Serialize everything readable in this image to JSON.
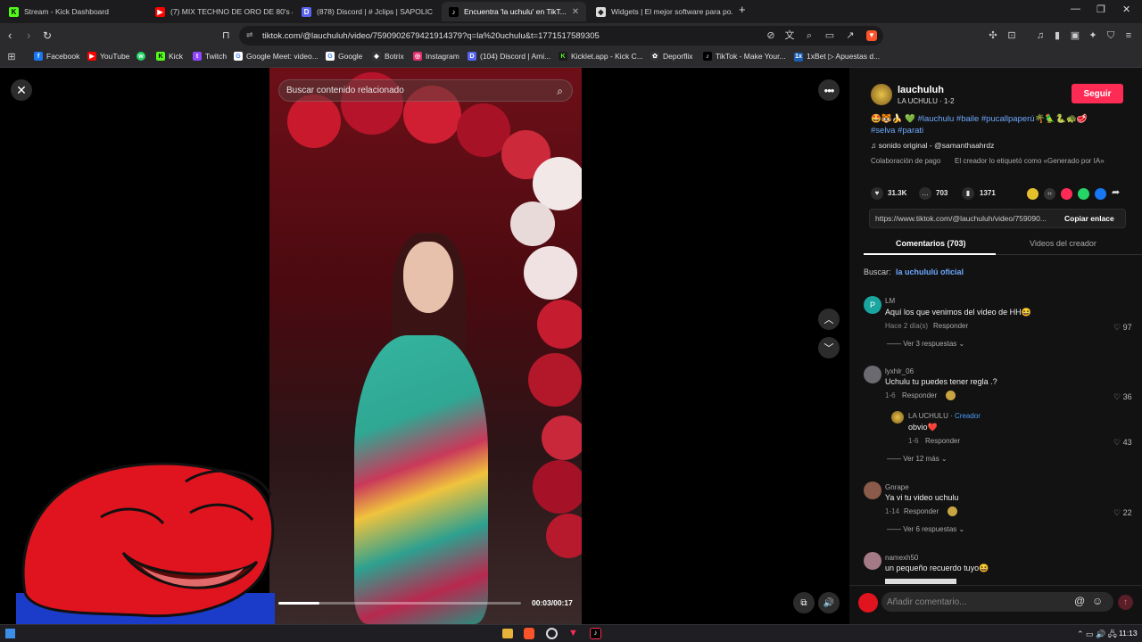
{
  "tabs": [
    {
      "label": "Stream - Kick Dashboard",
      "fav": "K",
      "color": "#53fc18"
    },
    {
      "label": "(7) MIX TECHNO DE ORO DE 80's &",
      "fav": "▶",
      "color": "#ff0000"
    },
    {
      "label": "(878) Discord | #​⁠ ⁠Jclips | SAPOLIC",
      "fav": "D",
      "color": "#5865f2"
    },
    {
      "label": "Encuentra 'la uchulu' en TikT...",
      "fav": "♪",
      "color": "#111"
    },
    {
      "label": "Widgets | El mejor software para po...",
      "fav": "◆",
      "color": "#444"
    }
  ],
  "url": "tiktok.com/@lauchuluh/video/7590902679421914379?q=la%20uchulu&t=1771517589305",
  "bookmarks": [
    {
      "label": "Facebook",
      "color": "#1877f2",
      "g": "f"
    },
    {
      "label": "YouTube",
      "color": "#ff0000",
      "g": "▶"
    },
    {
      "label": "",
      "color": "#25d366",
      "g": "w"
    },
    {
      "label": "Kick",
      "color": "#53fc18",
      "g": "K"
    },
    {
      "label": "Twitch",
      "color": "#9146ff",
      "g": "t"
    },
    {
      "label": "Google Meet: video...",
      "color": "#34a853",
      "g": "G"
    },
    {
      "label": "Google",
      "color": "#4285f4",
      "g": "G"
    },
    {
      "label": "Botrix",
      "color": "#777",
      "g": "◆"
    },
    {
      "label": "Instagram",
      "color": "#e1306c",
      "g": "◎"
    },
    {
      "label": "(104) Discord | Ami...",
      "color": "#5865f2",
      "g": "D"
    },
    {
      "label": "Kicklet.app - Kick C...",
      "color": "#53fc18",
      "g": "K"
    },
    {
      "label": "Deporflix",
      "color": "#999",
      "g": "✿"
    },
    {
      "label": "TikTok - Make Your...",
      "color": "#111",
      "g": "♪"
    },
    {
      "label": "1xBet ▷ Apuestas d...",
      "color": "#1b5fb5",
      "g": "1x"
    }
  ],
  "video": {
    "search_placeholder": "Buscar contenido relacionado",
    "time": "00:03/00:17",
    "progress": 0.17
  },
  "creator": {
    "username": "lauchuluh",
    "subtitle": "LA UCHULU · 1-2",
    "follow": "Seguir",
    "caption_line1": "🤩🐯🍌 💚 #lauchulu #baile #pucallpaperú🌴🦜🐍🐢🥩",
    "caption_line2": "#selva #parati",
    "sound": "sonido original - @samanthaahrdz",
    "paid": "Colaboración de pago",
    "ai_label": "El creador lo etiquetó como «Generado por IA»"
  },
  "stats": {
    "likes": "31.3K",
    "comments": "703",
    "saves": "1371"
  },
  "link": {
    "url": "https://www.tiktok.com/@lauchuluh/video/759090...",
    "copy": "Copiar enlace"
  },
  "tabs_panel": {
    "comments": "Comentarios (703)",
    "videos": "Videos del creador"
  },
  "buscar": {
    "label": "Buscar:",
    "term": "la uchululú oficial"
  },
  "comments": [
    {
      "user": "LM",
      "text": "Aquí los que venimos del video de HH😆",
      "meta": "Hace 2 día(s)",
      "reply": "Responder",
      "likes": "97",
      "more": "Ver 3 respuestas"
    },
    {
      "user": "lyxhlr_06",
      "text": "Uchulu tu puedes tener regla .?",
      "meta": "1-6",
      "reply": "Responder",
      "likes": "36"
    },
    {
      "user": "LA UCHULU",
      "badge": "Creador",
      "text": "obvio❤️",
      "meta": "1-6",
      "reply": "Responder",
      "likes": "43",
      "more": "Ver 12 más"
    },
    {
      "user": "Gnrape",
      "text": "Ya vi tu video uchulu",
      "meta": "1-14",
      "reply": "Responder",
      "likes": "22",
      "more": "Ver 6 respuestas"
    },
    {
      "user": "namexh50",
      "text": "un pequeño recuerdo tuyo😆"
    }
  ],
  "composer_placeholder": "Añadir comentario...",
  "clock": "11:13"
}
